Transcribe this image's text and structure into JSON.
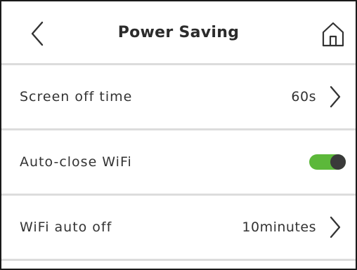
{
  "header": {
    "title": "Power Saving",
    "back_icon": "chevron-left-icon",
    "home_icon": "home-icon"
  },
  "settings": [
    {
      "label": "Screen off time",
      "value": "60s",
      "type": "link",
      "icon": "chevron-right-icon"
    },
    {
      "label": "Auto-close WiFi",
      "type": "toggle",
      "on": true
    },
    {
      "label": "WiFi auto off",
      "value": "10minutes",
      "type": "link",
      "icon": "chevron-right-icon"
    }
  ],
  "colors": {
    "toggle_on": "#5cb83a",
    "toggle_knob": "#3a3a3a",
    "divider": "#dcdcdc",
    "text": "#333333"
  }
}
